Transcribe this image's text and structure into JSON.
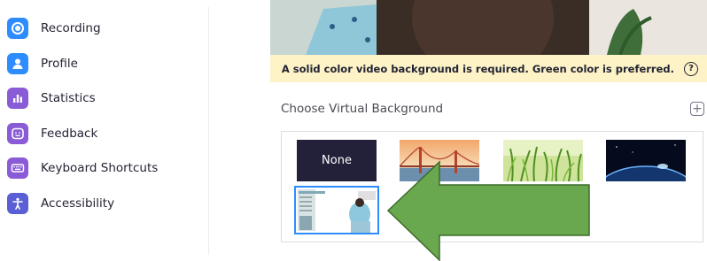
{
  "sidebar": {
    "items": [
      {
        "label": "Recording",
        "icon": "recording-icon",
        "color": "#2d8cff"
      },
      {
        "label": "Profile",
        "icon": "profile-icon",
        "color": "#2d8cff"
      },
      {
        "label": "Statistics",
        "icon": "statistics-icon",
        "color": "#8a5bd6"
      },
      {
        "label": "Feedback",
        "icon": "feedback-icon",
        "color": "#8a5bd6"
      },
      {
        "label": "Keyboard Shortcuts",
        "icon": "keyboard-icon",
        "color": "#8a5bd6"
      },
      {
        "label": "Accessibility",
        "icon": "accessibility-icon",
        "color": "#5a5fd6"
      }
    ]
  },
  "main": {
    "warning": "A solid color video background is required. Green color is preferred.",
    "help_glyph": "?",
    "section_title": "Choose Virtual Background",
    "add_glyph": "+",
    "backgrounds": [
      {
        "label": "None",
        "type": "none"
      },
      {
        "type": "golden-gate"
      },
      {
        "type": "grass"
      },
      {
        "type": "earth"
      },
      {
        "type": "custom-image",
        "selected": true
      }
    ]
  },
  "colors": {
    "accent": "#2d8cff",
    "warning_bg": "#fdf3c7",
    "annotation_arrow": "#6aa84f"
  }
}
